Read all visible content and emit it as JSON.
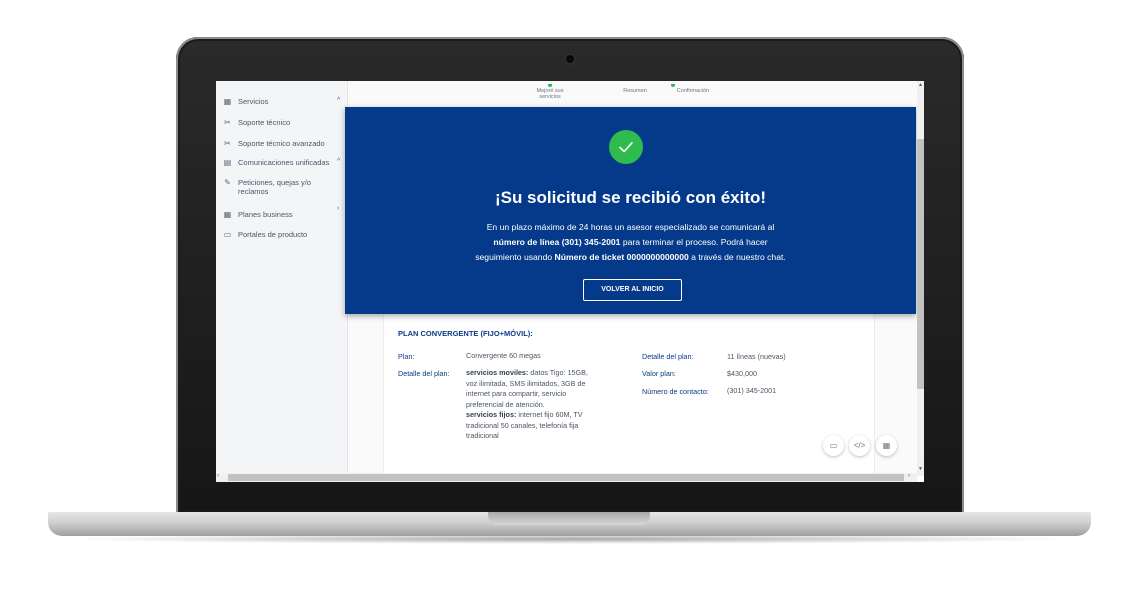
{
  "sidebar": {
    "items": [
      {
        "label": "Servicios",
        "icon": "grid-icon"
      },
      {
        "label": "Soporte técnico",
        "icon": "tools-icon"
      },
      {
        "label": "Soporte técnico avanzado",
        "icon": "tools-icon"
      },
      {
        "label": "Comunicaciones unificadas",
        "icon": "document-icon"
      },
      {
        "label": "Peticiones, quejas y/o reclamos",
        "icon": "edit-icon"
      },
      {
        "label": "Planes business",
        "icon": "grid-icon"
      },
      {
        "label": "Portales de producto",
        "icon": "portal-icon"
      }
    ]
  },
  "steps": {
    "step1": "Mejoré sus servicios",
    "step2": "Resumen",
    "step3": "Confirmación"
  },
  "modal": {
    "title": "¡Su solicitud se recibió con éxito!",
    "text_1": "En un plazo máximo de 24 horas un asesor especializado se comunicará al",
    "line_strong": "número de línea (301) 345-2001",
    "text_2": " para terminar el proceso. Podrá hacer",
    "text_3": "seguimiento usando ",
    "ticket_strong": "Número de ticket 0000000000000",
    "text_4": " a través de nuestro chat.",
    "button": "VOLVER AL INICIO",
    "accent_color": "#053a8a",
    "success_color": "#2ebc4f"
  },
  "plan": {
    "title": "PLAN CONVERGENTE (FIJO+MÓVIL):",
    "plan_label": "Plan:",
    "plan_value": "Convergente 60 megas",
    "detail_label": "Detalle del plan:",
    "mobile_strong": "servicios moviles:",
    "mobile_text": " datos Tigo: 15GB, voz ilimitada, SMS ilimitados,  3GB de internet para compartir, servicio preferencial de atención.",
    "fixed_strong": "servicios fijos:",
    "fixed_text": " internet fijo 60M, TV tradicional 50 canales, telefonía fija tradicional",
    "detail_label_right": "Detalle del plan:",
    "detail_value_right": "11 líneas (nuevas)",
    "value_label": "Valor plan:",
    "value_value": "$430,000",
    "contact_label": "Número de contacto:",
    "contact_value": "(301) 345-2001"
  }
}
